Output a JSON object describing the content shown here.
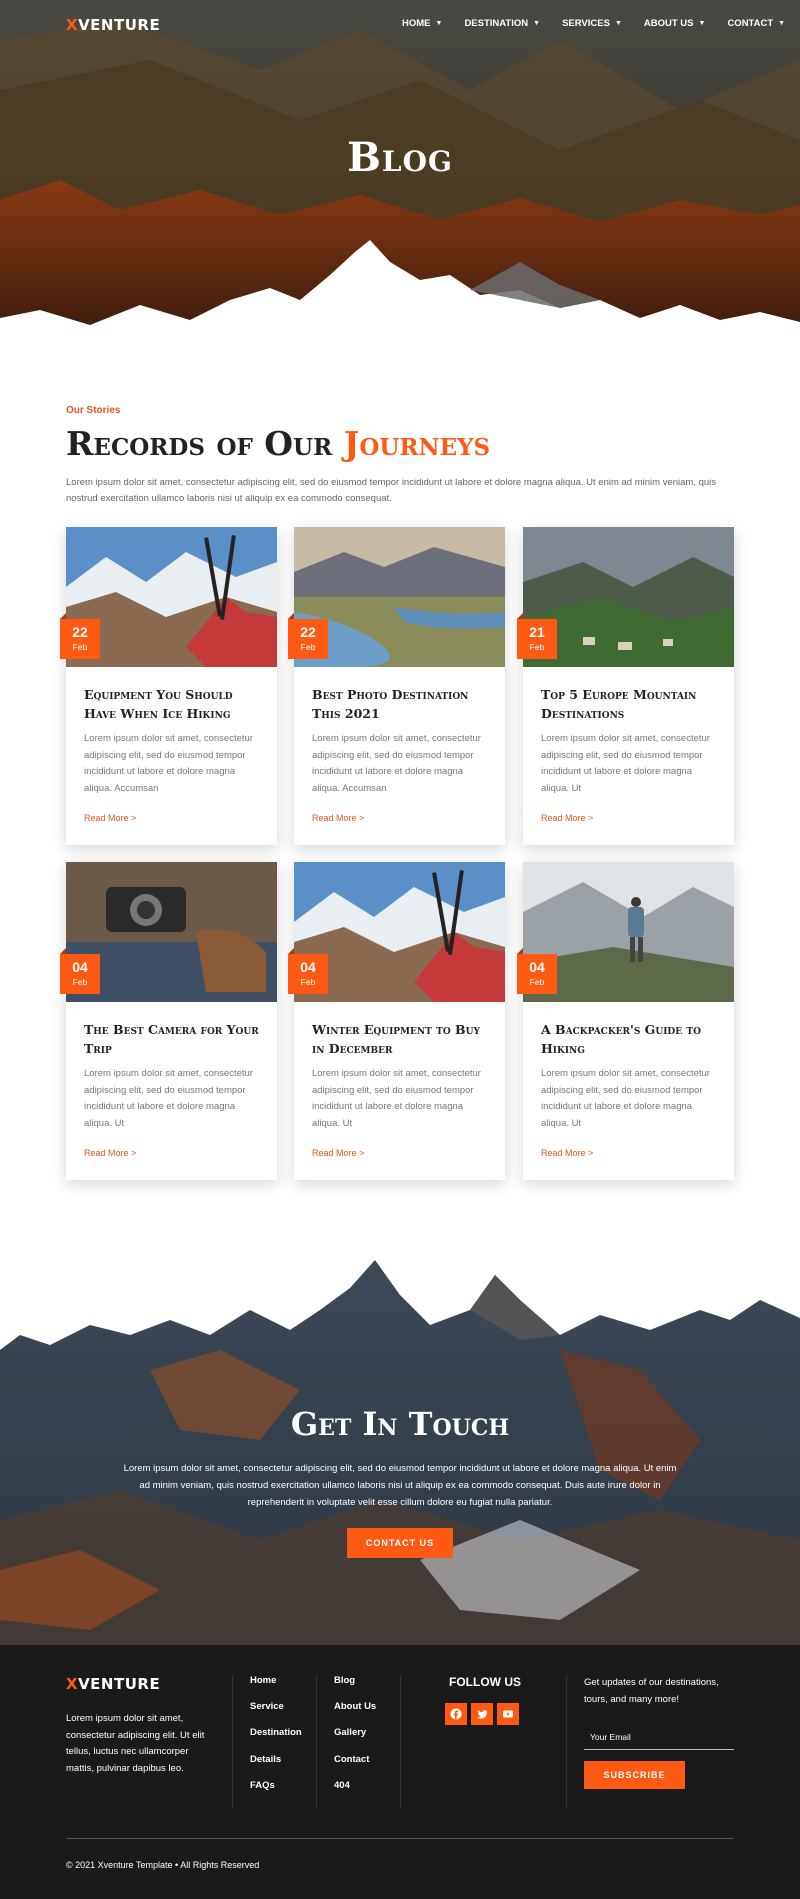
{
  "brand": {
    "logo_x": "X",
    "logo_rest": "VENTURE"
  },
  "nav": {
    "items": [
      {
        "label": "HOME"
      },
      {
        "label": "DESTINATION"
      },
      {
        "label": "SERVICES"
      },
      {
        "label": "ABOUT US"
      },
      {
        "label": "CONTACT"
      }
    ]
  },
  "hero": {
    "title": "Blog"
  },
  "records": {
    "eyebrow": "Our Stories",
    "headline_main": "Records of Our ",
    "headline_accent": "Journeys",
    "intro": "Lorem ipsum dolor sit amet, consectetur adipiscing elit, sed do eiusmod tempor incididunt ut labore et dolore magna aliqua. Ut enim ad minim veniam, quis nostrud exercitation ullamco laboris nisi ut aliquip ex ea commodo consequat."
  },
  "posts": [
    {
      "day": "22",
      "month": "Feb",
      "title": "Equipment You Should Have When Ice Hiking",
      "excerpt": "Lorem ipsum dolor sit amet, consectetur adipiscing elit, sed do eiusmod tempor incididunt ut labore et dolore magna aliqua. Accumsan",
      "link": "Read More >"
    },
    {
      "day": "22",
      "month": "Feb",
      "title": "Best Photo Destination This 2021",
      "excerpt": "Lorem ipsum dolor sit amet, consectetur adipiscing elit, sed do eiusmod tempor incididunt ut labore et dolore magna aliqua. Accumsan",
      "link": "Read More >"
    },
    {
      "day": "21",
      "month": "Feb",
      "title": "Top 5 Europe Mountain Destinations",
      "excerpt": "Lorem ipsum dolor sit amet, consectetur adipiscing elit, sed do eiusmod tempor incididunt ut labore et dolore magna aliqua. Ut",
      "link": "Read More >"
    },
    {
      "day": "04",
      "month": "Feb",
      "title": "The Best Camera for Your Trip",
      "excerpt": "Lorem ipsum dolor sit amet, consectetur adipiscing elit, sed do eiusmod tempor incididunt ut labore et dolore magna aliqua. Ut",
      "link": "Read More >"
    },
    {
      "day": "04",
      "month": "Feb",
      "title": "Winter Equipment to Buy in December",
      "excerpt": "Lorem ipsum dolor sit amet, consectetur adipiscing elit, sed do eiusmod tempor incididunt ut labore et dolore magna aliqua. Ut",
      "link": "Read More >"
    },
    {
      "day": "04",
      "month": "Feb",
      "title": "A Backpacker's Guide to Hiking",
      "excerpt": "Lorem ipsum dolor sit amet, consectetur adipiscing elit, sed do eiusmod tempor incididunt ut labore et dolore magna aliqua. Ut",
      "link": "Read More >"
    }
  ],
  "touch": {
    "title": "Get In Touch",
    "text": "Lorem ipsum dolor sit amet, consectetur adipiscing elit, sed do eiusmod tempor incididunt ut labore et dolore magna aliqua. Ut enim ad minim veniam, quis nostrud exercitation ullamco laboris nisi ut aliquip ex ea commodo consequat. Duis aute irure dolor in reprehenderit in voluptate velit esse cillum dolore eu fugiat nulla pariatur.",
    "button": "CONTACT US"
  },
  "footer": {
    "about": "Lorem ipsum dolor sit amet, consectetur adipiscing elit. Ut elit tellus, luctus nec ullamcorper mattis, pulvinar dapibus leo.",
    "links_col1": [
      "Home",
      "Service",
      "Destination",
      "Details",
      "FAQs"
    ],
    "links_col2": [
      "Blog",
      "About Us",
      "Gallery",
      "Contact",
      "404"
    ],
    "follow_title": "FOLLOW US",
    "social_icons": [
      "facebook-icon",
      "twitter-icon",
      "youtube-icon"
    ],
    "updates_text": "Get updates of our destinations, tours, and many more!",
    "email_placeholder": "Your Email",
    "subscribe": "SUBSCRIBE",
    "copyright": "© 2021 Xventure Template • All Rights Reserved"
  },
  "colors": {
    "accent": "#ff5a13",
    "footer_bg": "#1a1a1a",
    "heading": "#222222"
  }
}
